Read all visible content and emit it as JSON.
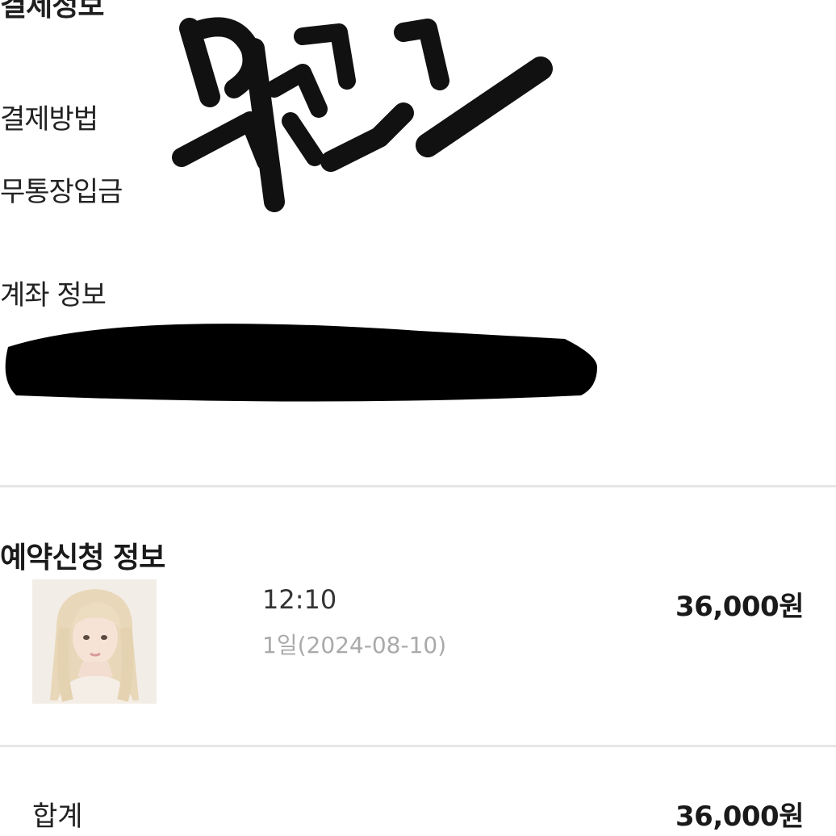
{
  "payment_section": {
    "title": "결제정보",
    "method_label": "결제방법",
    "method_value": "무통장입금",
    "account_label": "계좌 정보",
    "account_value": ""
  },
  "reservation_section": {
    "title": "예약신청 정보",
    "item": {
      "time": "12:10",
      "date": "1일(2024-08-10)",
      "price": "36,000원",
      "thumbnail": "profile-photo"
    }
  },
  "summary": {
    "total_label": "합계",
    "total_price": "36,000원"
  },
  "colors": {
    "text_primary": "#1a1a1a",
    "text_secondary": "#aaaaaa",
    "divider": "#e6e6e6",
    "redaction": "#000000"
  }
}
